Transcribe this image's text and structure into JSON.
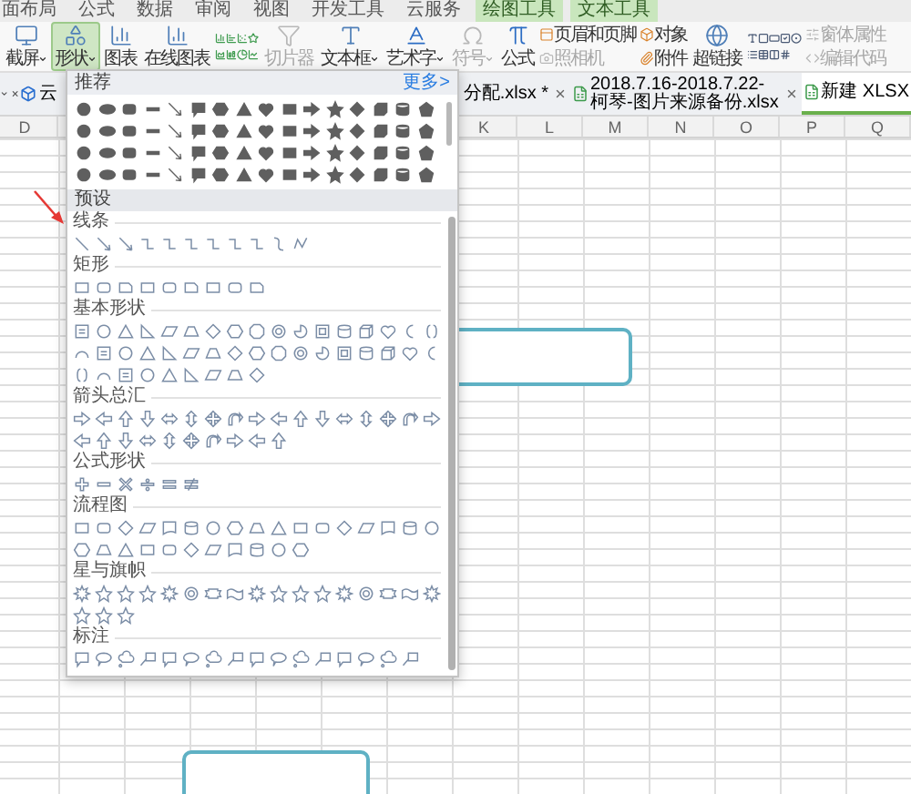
{
  "menu_tabs": [
    {
      "label": "面布局",
      "contextual": false
    },
    {
      "label": "公式",
      "contextual": false
    },
    {
      "label": "数据",
      "contextual": false
    },
    {
      "label": "审阅",
      "contextual": false
    },
    {
      "label": "视图",
      "contextual": false
    },
    {
      "label": "开发工具",
      "contextual": false
    },
    {
      "label": "云服务",
      "contextual": false
    },
    {
      "label": "绘图工具",
      "contextual": true
    },
    {
      "label": "文本工具",
      "contextual": true
    }
  ],
  "ribbon": [
    {
      "kind": "large",
      "label": "截屏",
      "dropdown": true,
      "selected": false,
      "disabled": false
    },
    {
      "kind": "large",
      "label": "形状",
      "dropdown": true,
      "selected": true,
      "disabled": false
    },
    {
      "kind": "large",
      "label": "图表",
      "dropdown": false,
      "selected": false,
      "disabled": false
    },
    {
      "kind": "large",
      "label": "在线图表",
      "dropdown": false,
      "selected": false,
      "disabled": false
    },
    {
      "kind": "chart_icons"
    },
    {
      "kind": "large",
      "label": "切片器",
      "dropdown": false,
      "selected": false,
      "disabled": true
    },
    {
      "kind": "large",
      "label": "文本框",
      "dropdown": true,
      "selected": false,
      "disabled": false
    },
    {
      "kind": "large",
      "label": "艺术字",
      "dropdown": true,
      "selected": false,
      "disabled": false
    },
    {
      "kind": "large",
      "label": "符号",
      "dropdown": true,
      "selected": false,
      "disabled": true
    },
    {
      "kind": "large",
      "label": "公式",
      "dropdown": false,
      "selected": false,
      "disabled": false
    },
    {
      "kind": "stacked",
      "items": [
        {
          "label": "页眉和页脚",
          "disabled": false
        },
        {
          "label": "照相机",
          "disabled": true
        }
      ]
    },
    {
      "kind": "stacked",
      "items": [
        {
          "label": "对象",
          "disabled": false
        },
        {
          "label": "附件",
          "disabled": false
        }
      ]
    },
    {
      "kind": "large",
      "label": "超链接",
      "dropdown": false,
      "selected": false,
      "disabled": false
    },
    {
      "kind": "form_icons"
    },
    {
      "kind": "stacked",
      "items": [
        {
          "label": "窗体属性",
          "disabled": true
        },
        {
          "label": "编辑代码",
          "disabled": true
        }
      ]
    }
  ],
  "file_tabs": [
    {
      "label": "云",
      "selected": false
    },
    {
      "label": "分配.xlsx *",
      "selected": false
    },
    {
      "label": "2018.7.16-2018.7.22-柯琴-图片来源备份.xlsx",
      "selected": false
    },
    {
      "label": "新建 XLSX",
      "selected": true
    }
  ],
  "columns": [
    "D",
    "K",
    "L",
    "M",
    "N",
    "O",
    "P",
    "Q"
  ],
  "shapes_menu": {
    "title": "推荐",
    "more": "更多>",
    "preset": "预设",
    "sections": [
      {
        "label": "线条"
      },
      {
        "label": "矩形"
      },
      {
        "label": "基本形状"
      },
      {
        "label": "箭头总汇"
      },
      {
        "label": "公式形状"
      },
      {
        "label": "流程图"
      },
      {
        "label": "星与旗帜"
      },
      {
        "label": "标注"
      }
    ]
  }
}
